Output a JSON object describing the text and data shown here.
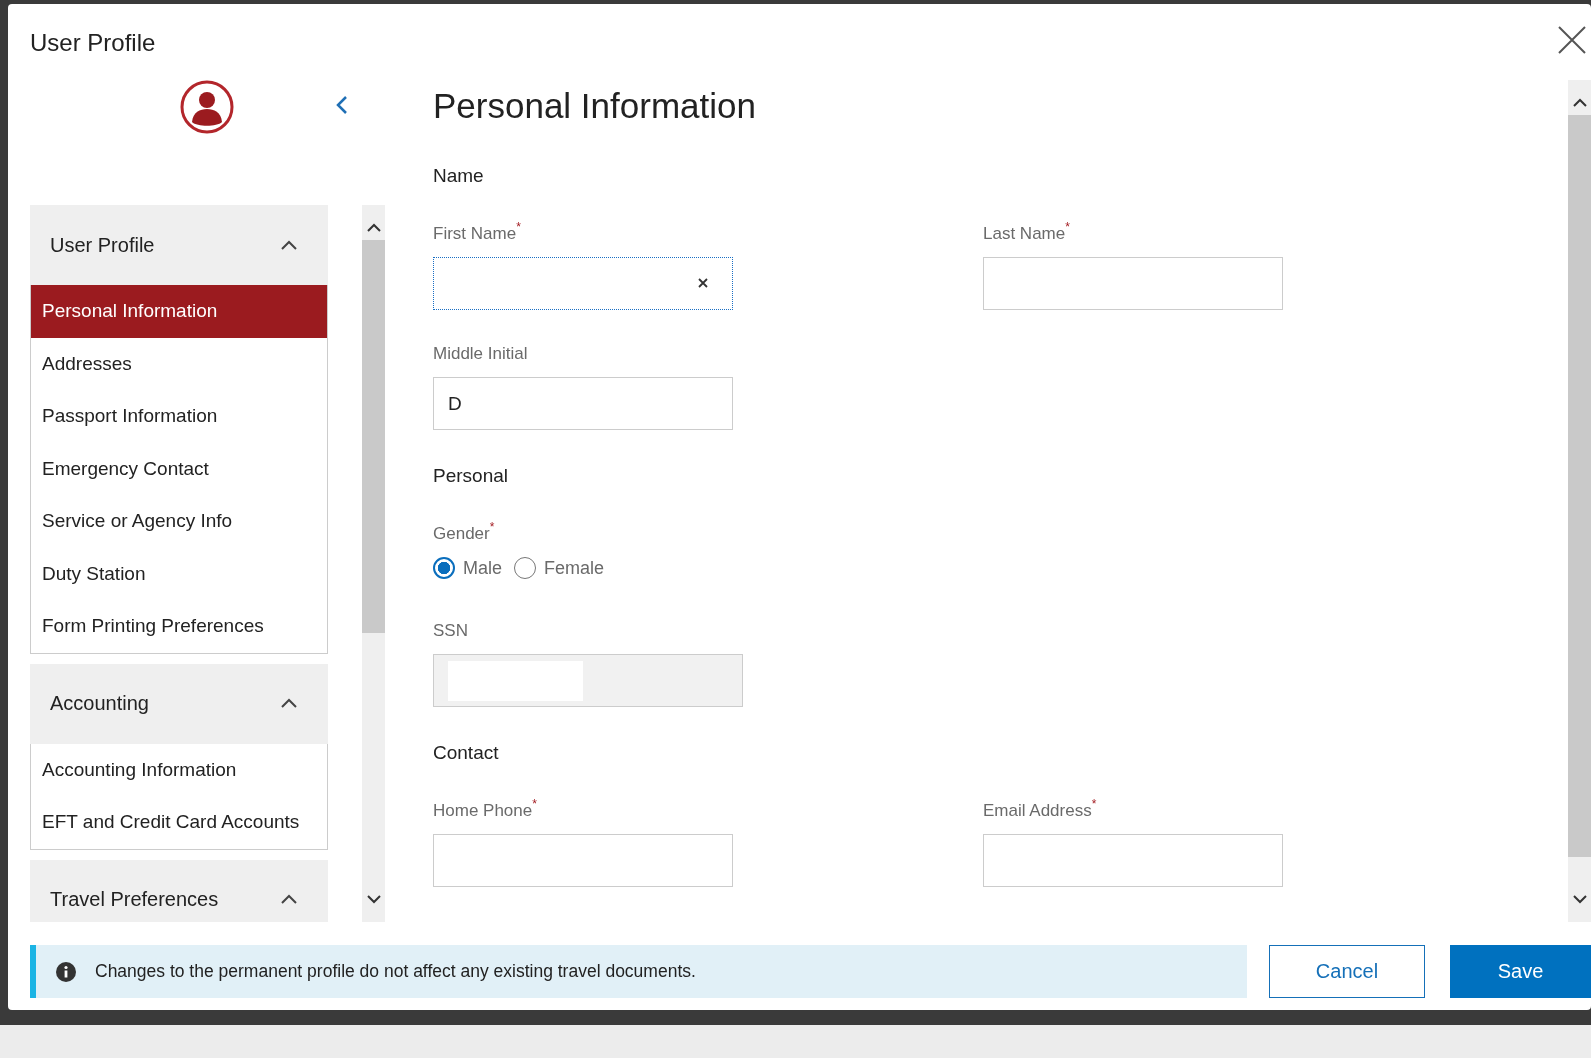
{
  "window": {
    "title": "User Profile"
  },
  "sidebar": {
    "sections": [
      {
        "title": "User Profile",
        "expanded": true,
        "items": [
          {
            "label": "Personal Information",
            "selected": true
          },
          {
            "label": "Addresses",
            "selected": false
          },
          {
            "label": "Passport Information",
            "selected": false
          },
          {
            "label": "Emergency Contact",
            "selected": false
          },
          {
            "label": "Service or Agency Info",
            "selected": false
          },
          {
            "label": "Duty Station",
            "selected": false
          },
          {
            "label": "Form Printing Preferences",
            "selected": false
          }
        ]
      },
      {
        "title": "Accounting",
        "expanded": true,
        "items": [
          {
            "label": "Accounting Information",
            "selected": false
          },
          {
            "label": "EFT and Credit Card Accounts",
            "selected": false
          }
        ]
      },
      {
        "title": "Travel Preferences",
        "expanded": true
      }
    ]
  },
  "main": {
    "heading": "Personal Information",
    "groups": [
      {
        "title": "Name",
        "rows": [
          {
            "fields": [
              {
                "kind": "text",
                "label": "First Name",
                "required_mark": "*",
                "focused": true
              },
              {
                "kind": "text",
                "label": "Last Name",
                "required_mark": "*",
                "focused": false
              }
            ]
          },
          {
            "fields": [
              {
                "kind": "text",
                "label": "Middle Initial",
                "value": "D",
                "focused": false
              }
            ]
          }
        ]
      },
      {
        "title": "Personal",
        "rows": [
          {
            "fields": [
              {
                "kind": "radio",
                "label": "Gender",
                "required_mark": "*",
                "options": [
                  {
                    "label": "Male",
                    "selected": true
                  },
                  {
                    "label": "Female",
                    "selected": false
                  }
                ]
              }
            ]
          },
          {
            "fields": [
              {
                "kind": "masked",
                "label": "SSN"
              }
            ]
          }
        ]
      },
      {
        "title": "Contact",
        "rows": [
          {
            "fields": [
              {
                "kind": "text",
                "label": "Home Phone",
                "required_mark": "*",
                "focused": false
              },
              {
                "kind": "text",
                "label": "Email Address",
                "required_mark": "*",
                "focused": false
              }
            ]
          }
        ]
      }
    ]
  },
  "footer": {
    "notice": "Changes to the permanent profile do not affect any existing travel documents.",
    "buttons": [
      {
        "label": "Cancel",
        "kind": "secondary"
      },
      {
        "label": "Save",
        "kind": "primary"
      }
    ]
  }
}
